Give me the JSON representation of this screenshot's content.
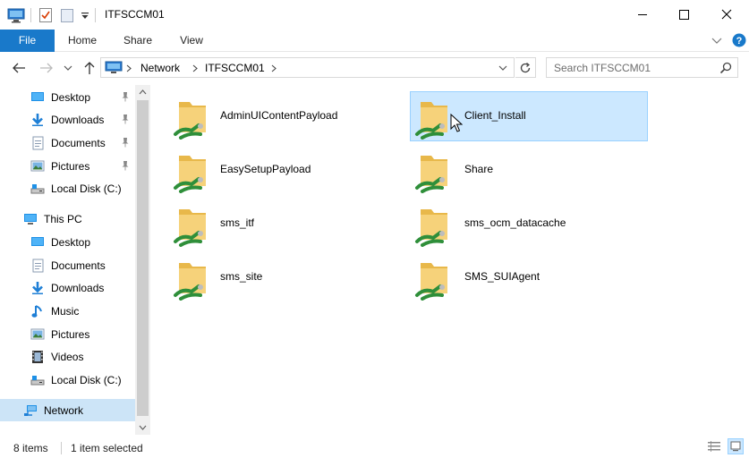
{
  "window": {
    "title": "ITFSCCM01"
  },
  "ribbon": {
    "tabs": [
      {
        "label": "File"
      },
      {
        "label": "Home"
      },
      {
        "label": "Share"
      },
      {
        "label": "View"
      }
    ]
  },
  "address": {
    "segments": [
      "Network",
      "ITFSCCM01"
    ],
    "search_placeholder": "Search ITFSCCM01"
  },
  "nav": {
    "quick_access": [
      {
        "label": "Desktop",
        "icon": "desktop-icon"
      },
      {
        "label": "Downloads",
        "icon": "downloads-icon"
      },
      {
        "label": "Documents",
        "icon": "documents-icon"
      },
      {
        "label": "Pictures",
        "icon": "pictures-icon"
      },
      {
        "label": "Local Disk (C:)",
        "icon": "drive-icon"
      }
    ],
    "this_pc": {
      "label": "This PC",
      "items": [
        {
          "label": "Desktop",
          "icon": "desktop-icon"
        },
        {
          "label": "Documents",
          "icon": "documents-icon"
        },
        {
          "label": "Downloads",
          "icon": "downloads-icon"
        },
        {
          "label": "Music",
          "icon": "music-icon"
        },
        {
          "label": "Pictures",
          "icon": "pictures-icon"
        },
        {
          "label": "Videos",
          "icon": "videos-icon"
        },
        {
          "label": "Local Disk (C:)",
          "icon": "drive-icon"
        }
      ]
    },
    "network": {
      "label": "Network"
    }
  },
  "folders": [
    {
      "name": "AdminUIContentPayload"
    },
    {
      "name": "Client_Install",
      "selected": true
    },
    {
      "name": "EasySetupPayload"
    },
    {
      "name": "Share"
    },
    {
      "name": "sms_itf"
    },
    {
      "name": "sms_ocm_datacache"
    },
    {
      "name": "sms_site"
    },
    {
      "name": "SMS_SUIAgent"
    }
  ],
  "status": {
    "item_count": "8 items",
    "selection": "1 item selected"
  },
  "colors": {
    "accent": "#1979ca",
    "selection_bg": "#cce8ff",
    "selection_border": "#99d1ff"
  }
}
